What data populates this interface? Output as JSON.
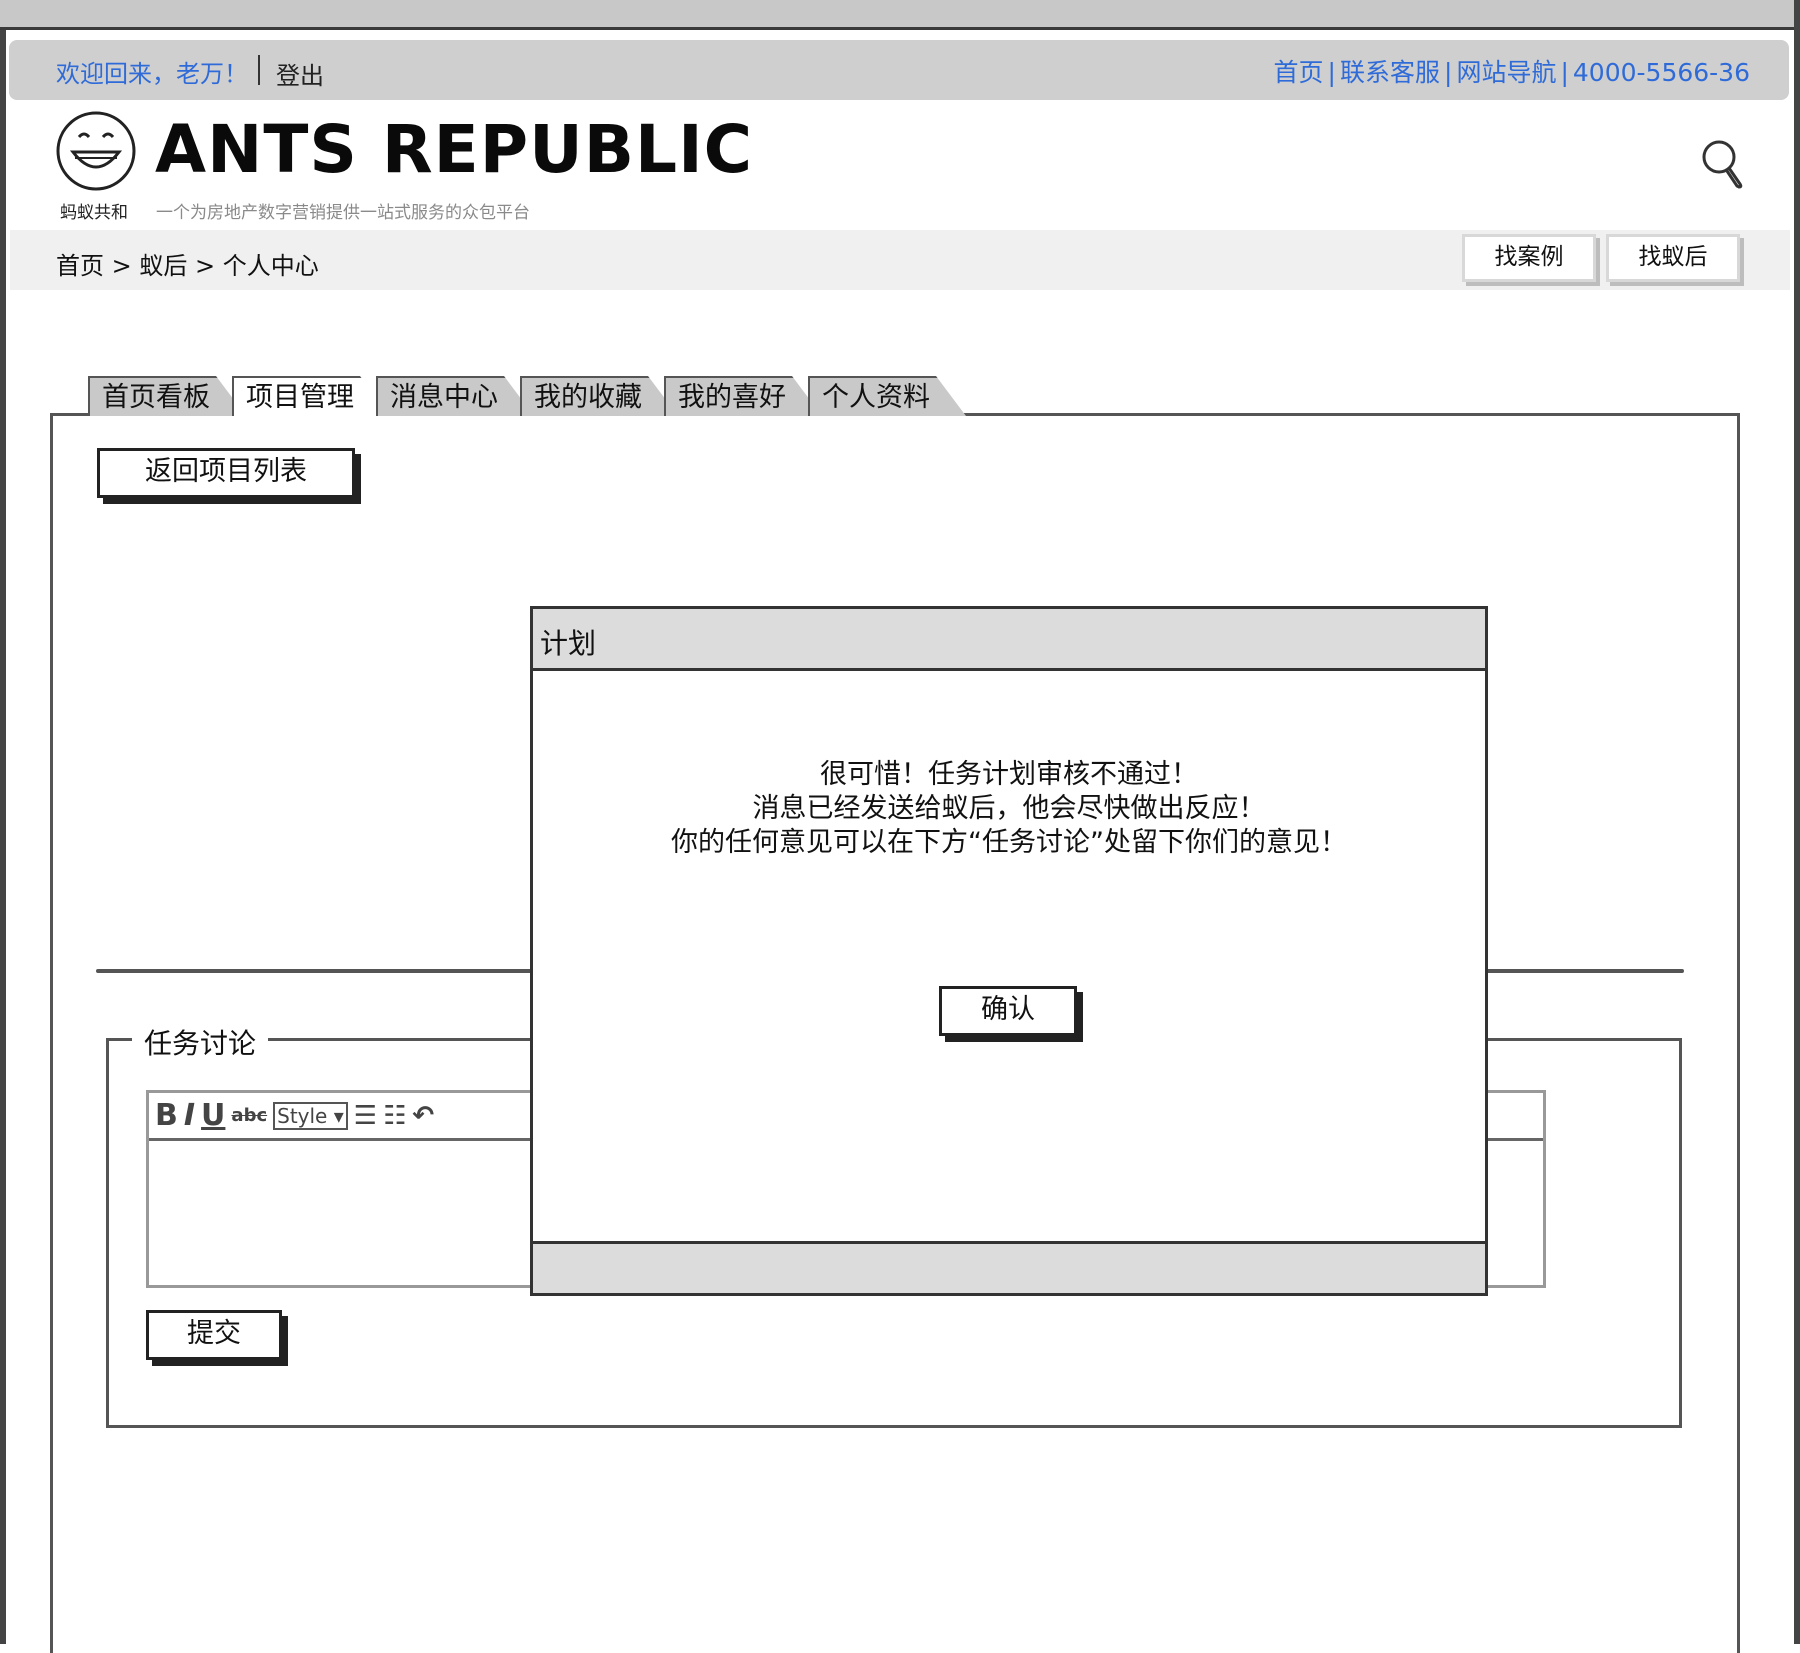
{
  "topbar": {
    "welcome": "欢迎回来，老万！",
    "logout": "登出",
    "links": [
      "首页",
      "联系客服",
      "网站导航",
      "4000-5566-36"
    ]
  },
  "header": {
    "logo_caption": "蚂蚁共和",
    "brand": "ANTS REPUBLIC",
    "slogan": "一个为房地产数字营销提供一站式服务的众包平台",
    "search_icon": "search-icon"
  },
  "breadcrumb": {
    "text": "首页 > 蚁后 > 个人中心",
    "buttons": {
      "find_case": "找案例",
      "find_queen": "找蚁后"
    }
  },
  "tabs": [
    "首页看板",
    "项目管理",
    "消息中心",
    "我的收藏",
    "我的喜好",
    "个人资料"
  ],
  "active_tab": "项目管理",
  "main": {
    "back_button": "返回项目列表",
    "discussion": {
      "legend": "任务讨论",
      "toolbar": {
        "bold": "B",
        "italic": "I",
        "underline": "U",
        "strike": "abc",
        "style": "Style"
      },
      "submit": "提交"
    }
  },
  "modal": {
    "title": "计划",
    "lines": [
      "很可惜！任务计划审核不通过！",
      "消息已经发送给蚁后，他会尽快做出反应！",
      "你的任何意见可以在下方“任务讨论”处留下你们的意见！"
    ],
    "confirm": "确认"
  }
}
